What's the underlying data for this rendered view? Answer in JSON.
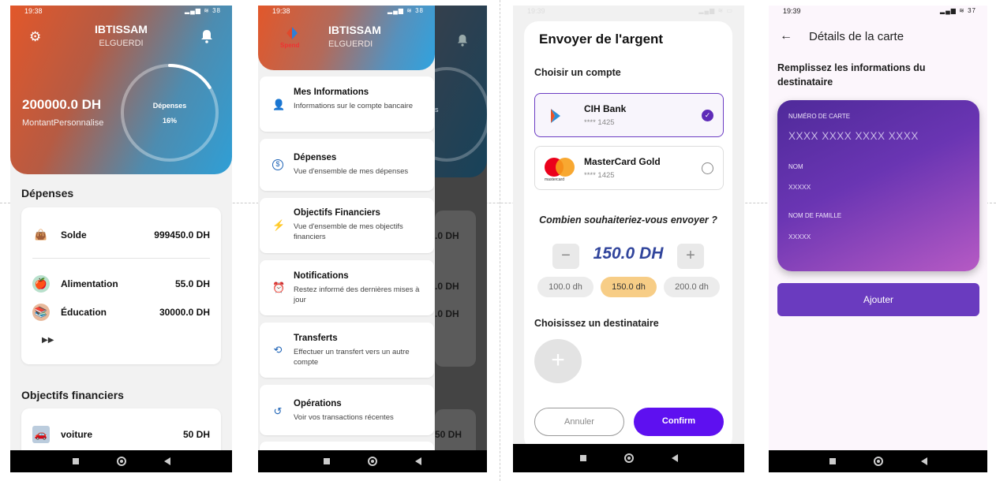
{
  "screen1": {
    "status_time": "19:38",
    "status_battery": "38",
    "user_first": "IBTISSAM",
    "user_last": "ELGUERDI",
    "amount": "200000.0 DH",
    "amount_label": "MontantPersonnalise",
    "ring_title": "Dépenses",
    "ring_percent": "16%",
    "ring_progress": 0.16,
    "expenses_title": "Dépenses",
    "solde_label": "Solde",
    "solde_value": "999450.0 DH",
    "items": [
      {
        "label": "Alimentation",
        "value": "55.0 DH",
        "icon": "apple-icon"
      },
      {
        "label": "Éducation",
        "value": "30000.0 DH",
        "icon": "education-icon"
      }
    ],
    "more_icon": "fast-forward-icon",
    "goals_title": "Objectifs financiers",
    "goal": {
      "label": "voiture",
      "value": "50 DH"
    }
  },
  "screen2": {
    "status_time": "19:38",
    "status_battery": "38",
    "logo_text": "Spend",
    "user_first": "IBTISSAM",
    "user_last": "ELGUERDI",
    "menu": [
      {
        "title": "Mes Informations",
        "subtitle": "Informations sur le compte bancaire",
        "icon": "person-icon"
      },
      {
        "title": "Dépenses",
        "subtitle": "Vue d'ensemble de mes dépenses",
        "icon": "dollar-icon"
      },
      {
        "title": "Objectifs Financiers",
        "subtitle": "Vue d'ensemble de mes objectifs financiers",
        "icon": "bolt-icon"
      },
      {
        "title": "Notifications",
        "subtitle": "Restez informé des dernières mises à jour",
        "icon": "alarm-icon"
      },
      {
        "title": "Transferts",
        "subtitle": "Effectuer un transfert vers un autre compte",
        "icon": "transfer-icon"
      },
      {
        "title": "Opérations",
        "subtitle": "Voir vos transactions récentes",
        "icon": "history-icon"
      }
    ],
    "bg_values": [
      ".0 DH",
      ".0 DH",
      ".0 DH",
      "50 DH"
    ],
    "bg_ring_text": "es"
  },
  "screen3": {
    "status_time": "19:39",
    "title": "Envoyer de l'argent",
    "choose_account": "Choisir un compte",
    "accounts": [
      {
        "name": "CIH Bank",
        "number": "**** 1425",
        "selected": true
      },
      {
        "name": "MasterCard Gold",
        "number": "**** 1425",
        "selected": false
      }
    ],
    "mastercard_word": "mastercard",
    "question": "Combien souhaiteriez-vous envoyer ?",
    "amount": "150.0 DH",
    "chips": [
      "100.0 dh",
      "150.0 dh",
      "200.0 dh"
    ],
    "selected_chip": 1,
    "choose_recipient": "Choisissez un destinataire",
    "cancel": "Annuler",
    "confirm": "Confirm",
    "accent": "#5e10f0"
  },
  "screen4": {
    "status_time": "19:39",
    "status_battery": "37",
    "title": "Détails de la carte",
    "instruction": "Remplissez les informations du destinataire",
    "card_number_label": "NUMÉRO DE CARTE",
    "card_number_placeholder": "XXXX XXXX XXXX XXXX",
    "name_label": "NOM",
    "name_value": "XXXXX",
    "family_label": "NOM DE FAMILLE",
    "family_value": "XXXXX",
    "add_button": "Ajouter",
    "accent": "#6a3bbf"
  }
}
